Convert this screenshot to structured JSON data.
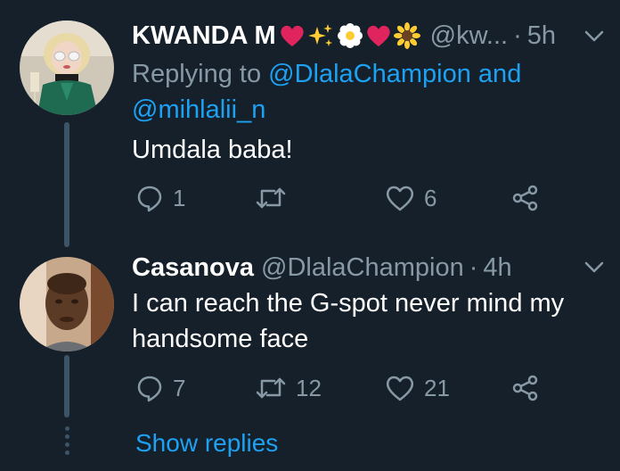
{
  "colors": {
    "background": "#15202b",
    "accent": "#1da1f2",
    "secondary_text": "#8899a6",
    "thread_line": "#3d5466"
  },
  "tweets": [
    {
      "name": "KWANDA M",
      "name_emojis": [
        "heart-icon",
        "sparkles-icon",
        "blossom-icon",
        "heart-icon",
        "sunflower-icon"
      ],
      "handle": "@kw...",
      "separator": "·",
      "time": "5h",
      "replying_prefix": "Replying to ",
      "replying_mention_1": "@DlalaChampion",
      "replying_conjunction": " and",
      "replying_mention_2": "@mihlalii_n",
      "text": "Umdala baba!",
      "reply_count": "1",
      "retweet_count": "",
      "like_count": "6"
    },
    {
      "name": "Casanova",
      "handle": "@DlalaChampion",
      "separator": "·",
      "time": "4h",
      "text": "I can reach the G-spot never mind my handsome face",
      "reply_count": "7",
      "retweet_count": "12",
      "like_count": "21"
    }
  ],
  "show_replies_label": "Show replies"
}
